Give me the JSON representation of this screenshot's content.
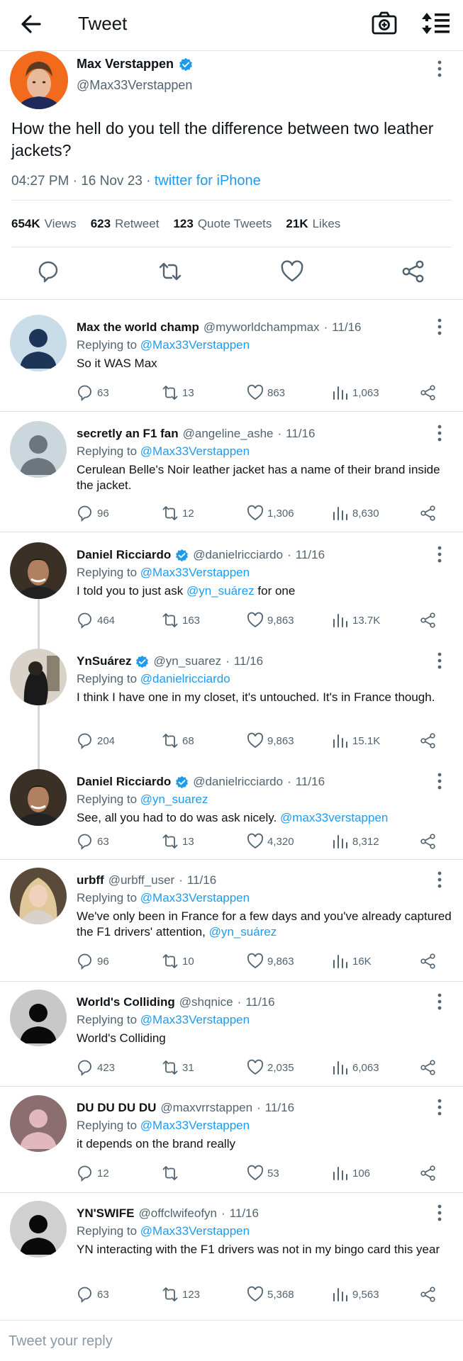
{
  "header": {
    "title": "Tweet",
    "back_icon": "arrow-left-icon",
    "camera_icon": "camera-icon",
    "sort_icon": "sort-icon"
  },
  "main_tweet": {
    "name": "Max Verstappen",
    "handle": "@Max33Verstappen",
    "text": "How the hell do you tell the difference between two leather jackets?",
    "time": "04:27 PM",
    "date": "16 Nov 23",
    "source": "twitter for iPhone",
    "stats": {
      "views_count": "654K",
      "views_label": "Views",
      "retweets_count": "623",
      "retweets_label": "Retweet",
      "quotes_count": "123",
      "quotes_label": "Quote Tweets",
      "likes_count": "21K",
      "likes_label": "Likes"
    }
  },
  "replies": [
    {
      "name": "Max the world champ",
      "verified": false,
      "handle": "@myworldchampmax",
      "date": "11/16",
      "replying_label": "Replying to",
      "replying_to": "@Max33Verstappen",
      "text": "So it WAS Max",
      "replies": "63",
      "retweets": "13",
      "likes": "863",
      "views": "1,063"
    },
    {
      "name": "secretly an F1 fan",
      "verified": false,
      "handle": "@angeline_ashe",
      "date": "11/16",
      "replying_label": "Replying to",
      "replying_to": "@Max33Verstappen",
      "text": "Cerulean Belle's Noir leather jacket has a name of their brand inside the jacket.",
      "replies": "96",
      "retweets": "12",
      "likes": "1,306",
      "views": "8,630"
    },
    {
      "name": "Daniel Ricciardo",
      "verified": true,
      "handle": "@danielricciardo",
      "date": "11/16",
      "replying_label": "Replying to",
      "replying_to": "@Max33Verstappen",
      "text_pre": "I told you to just ask ",
      "text_mention": "@yn_suárez",
      "text_post": " for one",
      "replies": "464",
      "retweets": "163",
      "likes": "9,863",
      "views": "13.7K"
    },
    {
      "name": "YnSuárez",
      "verified": true,
      "handle": "@yn_suarez",
      "date": "11/16",
      "replying_label": "Replying to",
      "replying_to": "@danielricciardo",
      "text": "I think I have one in my closet, it's untouched. It's in France though.",
      "replies": "204",
      "retweets": "68",
      "likes": "9,863",
      "views": "15.1K"
    },
    {
      "name": "Daniel Ricciardo",
      "verified": true,
      "handle": "@danielricciardo",
      "date": "11/16",
      "replying_label": "Replying to",
      "replying_to": "@yn_suarez",
      "text_pre": "See, all you had to do was ask nicely. ",
      "text_mention": "@max33verstappen",
      "replies": "63",
      "retweets": "13",
      "likes": "4,320",
      "views": "8,312"
    },
    {
      "name": "urbff",
      "verified": false,
      "handle": "@urbff_user",
      "date": "11/16",
      "replying_label": "Replying to",
      "replying_to": "@Max33Verstappen",
      "text_pre": "We've only been in France for a few days and you've already captured the F1 drivers' attention, ",
      "text_mention": "@yn_suárez",
      "replies": "96",
      "retweets": "10",
      "likes": "9,863",
      "views": "16K"
    },
    {
      "name": "World's Colliding",
      "verified": false,
      "handle": "@shqnice",
      "date": "11/16",
      "replying_label": "Replying to",
      "replying_to": "@Max33Verstappen",
      "text": "World's Colliding",
      "replies": "423",
      "retweets": "31",
      "likes": "2,035",
      "views": "6,063"
    },
    {
      "name": "DU DU DU DU",
      "verified": false,
      "handle": "@maxvrrstappen",
      "date": "11/16",
      "replying_label": "Replying to",
      "replying_to": "@Max33Verstappen",
      "text": "it depends on the brand really",
      "replies": "12",
      "retweets": "",
      "likes": "53",
      "views": "106"
    },
    {
      "name": "YN'SWIFE",
      "verified": false,
      "handle": "@offclwifeofyn",
      "date": "11/16",
      "replying_label": "Replying to",
      "replying_to": "@Max33Verstappen",
      "text": "YN interacting with the F1 drivers was not in my bingo card this year",
      "replies": "63",
      "retweets": "123",
      "likes": "5,368",
      "views": "9,563"
    }
  ],
  "reply_box": {
    "placeholder": "Tweet your reply"
  },
  "colors": {
    "accent": "#1d9bf0",
    "muted": "#536471",
    "text": "#0f1419"
  }
}
